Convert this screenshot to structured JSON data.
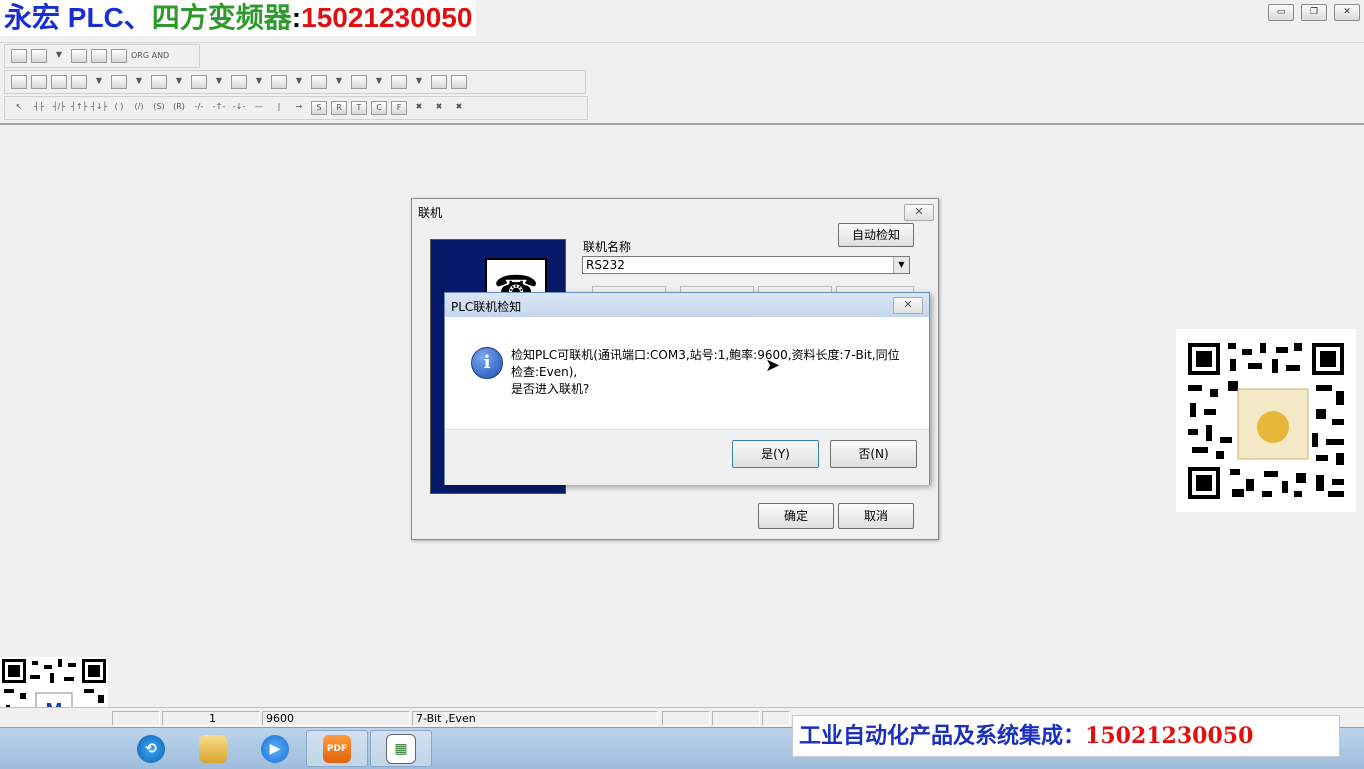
{
  "watermark": {
    "part1": "永宏 PLC、",
    "part2": "四方变频器",
    "part3": ":",
    "part4": "15021230050"
  },
  "window_controls": {
    "minimize": "▭",
    "restore": "❐",
    "close": "✕"
  },
  "toolbar": {
    "row1_text": "ORG AND"
  },
  "dialog": {
    "title": "联机",
    "close": "✕",
    "conn_name_label": "联机名称",
    "auto_detect_button": "自动检知",
    "combo_value": "RS232",
    "ok_button": "确定",
    "cancel_button": "取消"
  },
  "message_box": {
    "title": "PLC联机检知",
    "close": "✕",
    "line1": "检知PLC可联机(通讯端口:COM3,站号:1,鲍率:9600,资料长度:7-Bit,同位",
    "line2": "检查:Even),",
    "line3": "是否进入联机?",
    "yes_button": "是(Y)",
    "no_button": "否(N)",
    "icon": "info-icon"
  },
  "statusbar": {
    "station": "1",
    "baud": "9600",
    "format": "7-Bit ,Even"
  },
  "taskbar": {
    "pdf_label": "PDF"
  },
  "banner": {
    "text": "工业自动化产品及系统集成：",
    "phone": "15021230050"
  }
}
